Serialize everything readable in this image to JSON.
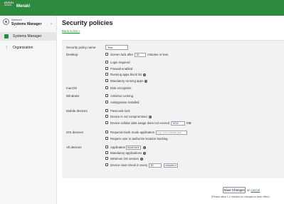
{
  "brand": {
    "cisco": "cisco",
    "product": "Meraki",
    "accent": "#2b8a3e"
  },
  "sidebar": {
    "network_label": "Network",
    "network_name": "Systems Manager",
    "items": [
      {
        "label": "Systems Manager",
        "icon": "systems-manager-icon",
        "active": true
      },
      {
        "label": "Organization",
        "icon": "organization-icon",
        "active": false
      }
    ]
  },
  "page": {
    "title": "Security policies",
    "back_link": "Back to list »"
  },
  "form": {
    "policy_name_label": "Security policy name",
    "policy_name_value": "Test",
    "sections": {
      "desktop": "Desktop",
      "macos": "macOS",
      "windows": "Windows",
      "mobile": "Mobile devices",
      "ios": "iOS devices",
      "all": "All devices"
    },
    "desktop": {
      "screen_lock_pre": "Screen lock after",
      "screen_lock_value": "15",
      "screen_lock_post": "minutes or less.",
      "login_required": "Login required",
      "firewall": "Firewall enabled",
      "running_apps_block": "Running apps block list",
      "mandatory_running": "Mandatory running apps"
    },
    "macos": {
      "disk_encryption": "Disk encryption"
    },
    "windows": {
      "antivirus": "Antivirus running",
      "antispyware": "Antispyware installed"
    },
    "mobile": {
      "passcode": "Passcode lock",
      "not_compromised": "Device is not compromised",
      "cellular_pre": "Device cellular data usage does not exceed",
      "cellular_value": "1024",
      "cellular_unit": "MB"
    },
    "ios": {
      "kiosk_label": "Required kiosk mode application",
      "kiosk_placeholder": "e.g. com.meraki.pcc",
      "location": "Require user to authorize location tracking"
    },
    "all": {
      "application": "Application",
      "application_select": "block list",
      "mandatory_apps": "Mandatory applications",
      "min_os": "Minimum OS version",
      "checkin_pre": "Device must check in every",
      "checkin_value": "30",
      "checkin_unit": "minutes"
    }
  },
  "footer": {
    "save": "Save Changes",
    "or": "or",
    "cancel": "cancel",
    "note": "(Please allow 1-2 minutes for changes to take effect.)"
  }
}
